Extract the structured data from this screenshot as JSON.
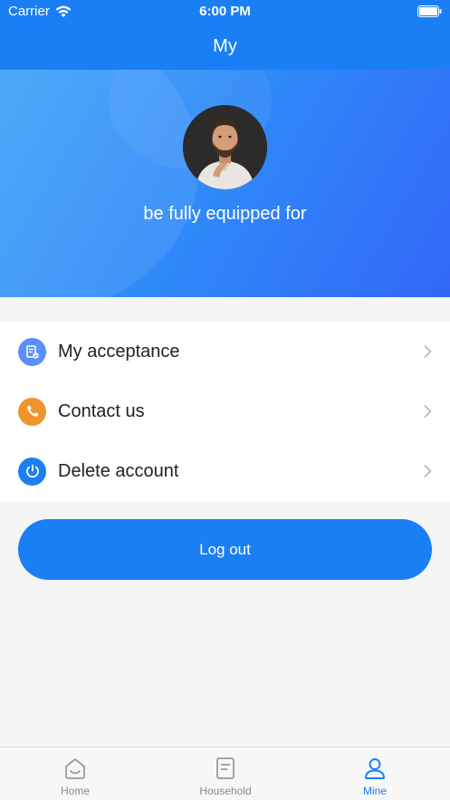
{
  "status_bar": {
    "carrier": "Carrier",
    "time": "6:00 PM"
  },
  "nav": {
    "title": "My"
  },
  "profile": {
    "name": "be fully equipped for"
  },
  "menu": {
    "items": [
      {
        "label": "My acceptance",
        "icon": "document-check-icon",
        "color": "#5b8ff9"
      },
      {
        "label": "Contact us",
        "icon": "phone-icon",
        "color": "#f0952d"
      },
      {
        "label": "Delete account",
        "icon": "power-icon",
        "color": "#1a7ff5"
      }
    ]
  },
  "logout": {
    "label": "Log out"
  },
  "tabs": [
    {
      "label": "Home",
      "icon": "home-icon",
      "active": false
    },
    {
      "label": "Household",
      "icon": "document-icon",
      "active": false
    },
    {
      "label": "Mine",
      "icon": "person-icon",
      "active": true
    }
  ],
  "colors": {
    "primary": "#1a7ff5",
    "tab_inactive": "#8a8a8a"
  }
}
